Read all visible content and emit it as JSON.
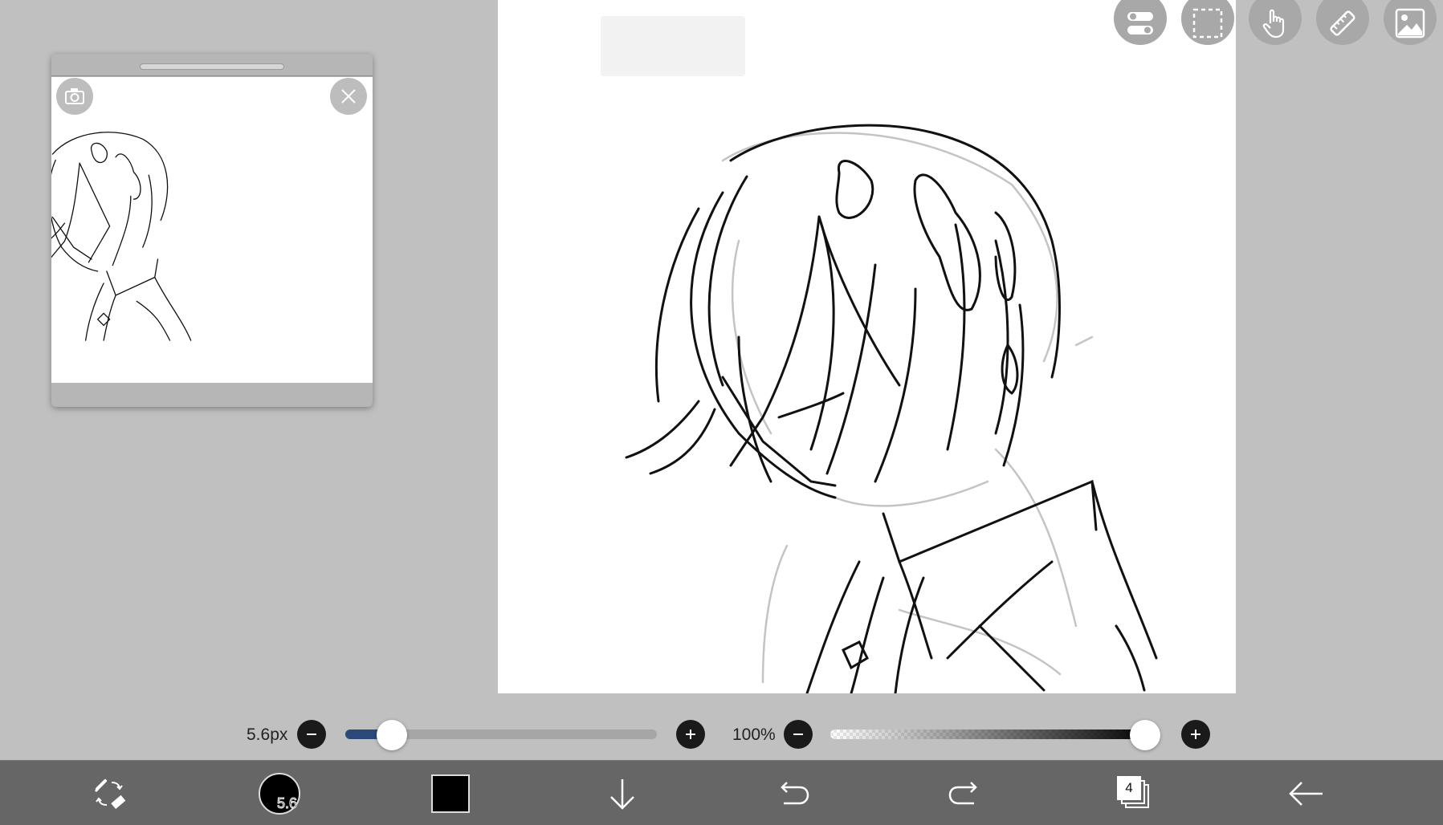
{
  "brush": {
    "size_label": "5.6px",
    "size_value": 5.6,
    "size_fraction": 0.15,
    "badge": "5.6"
  },
  "opacity": {
    "label": "100%",
    "fraction": 1.0
  },
  "layers": {
    "count": "4"
  },
  "colors": {
    "brush_color": "#000000",
    "size_fill": "#2b4a7a",
    "toolbar_bg": "#666666",
    "background": "#c0c0c0"
  },
  "top_tools": [
    {
      "name": "toggle-panel-icon"
    },
    {
      "name": "selection-icon"
    },
    {
      "name": "hand-tool-icon"
    },
    {
      "name": "ruler-icon"
    },
    {
      "name": "image-material-icon"
    }
  ],
  "bottom_tools": [
    "brush-eraser-swap-icon",
    "brush-size-icon",
    "color-swatch",
    "download-icon",
    "undo-icon",
    "redo-icon",
    "layers-icon",
    "back-icon"
  ],
  "reference_window": {
    "camera": "camera-icon",
    "close": "close-icon"
  }
}
